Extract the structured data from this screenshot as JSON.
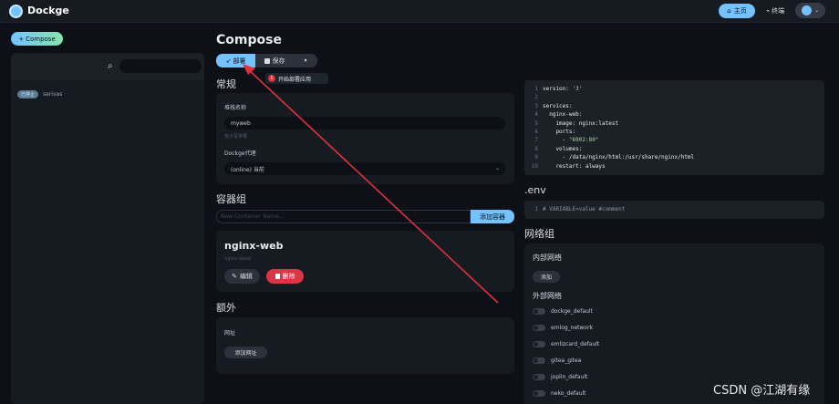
{
  "header": {
    "brand": "Dockge",
    "home_label": "主页",
    "terminal_label": "终端",
    "terminal_glyph": "⌁"
  },
  "sidebar": {
    "compose_label": "Compose",
    "search_placeholder": "",
    "stacks": [
      {
        "status": "已停止",
        "name": "serivas"
      }
    ]
  },
  "main": {
    "title": "Compose",
    "deploy_label": "部署",
    "save_label": "保存",
    "tooltip": {
      "number": "1",
      "text": "开始部署应用"
    },
    "general": {
      "heading": "常规",
      "stack_name_label": "堆栈名称",
      "stack_name_value": "myweb",
      "stack_name_hint": "仅小写字母",
      "agent_label": "Dockge代理",
      "agent_value": "(online) 当前"
    },
    "containers": {
      "heading": "容器组",
      "input_placeholder": "New Container Name...",
      "add_label": "添加容器",
      "items": [
        {
          "name": "nginx-web",
          "image": "nginx:latest",
          "edit_label": "编辑",
          "delete_label": "删除"
        }
      ]
    },
    "extra": {
      "heading": "额外",
      "url_label": "网址",
      "add_url_label": "添加网址"
    }
  },
  "editor": {
    "yaml_lines": [
      [
        {
          "t": "version: ",
          "c": "key"
        },
        {
          "t": "'3'",
          "c": "str"
        }
      ],
      [],
      [
        {
          "t": "services:",
          "c": "key"
        }
      ],
      [
        {
          "t": "  nginx-web:",
          "c": "key"
        }
      ],
      [
        {
          "t": "    image: nginx:latest",
          "c": "key"
        }
      ],
      [
        {
          "t": "    ports:",
          "c": "key"
        }
      ],
      [
        {
          "t": "      - ",
          "c": "key"
        },
        {
          "t": "\"6002:80\"",
          "c": "str"
        }
      ],
      [
        {
          "t": "    volumes:",
          "c": "key"
        }
      ],
      [
        {
          "t": "      - /data/nginx/html:/usr/share/nginx/html",
          "c": "key"
        }
      ],
      [
        {
          "t": "    restart: always",
          "c": "key"
        }
      ]
    ],
    "env_heading": ".env",
    "env_lines": [
      [
        {
          "t": "# VARIABLE=value #comment",
          "c": "cmt"
        }
      ]
    ]
  },
  "networks": {
    "heading": "网络组",
    "internal_heading": "内部网络",
    "add_label": "添加",
    "external_heading": "外部网络",
    "external": [
      "dockge_default",
      "emlog_network",
      "emlizcard_default",
      "gitea_gitea",
      "joplin_default",
      "neko_default"
    ]
  },
  "watermark": "CSDN @江湖有缘",
  "colors": {
    "accent": "#74c2ff",
    "danger": "#dc3545",
    "arrow": "#e0313b"
  }
}
